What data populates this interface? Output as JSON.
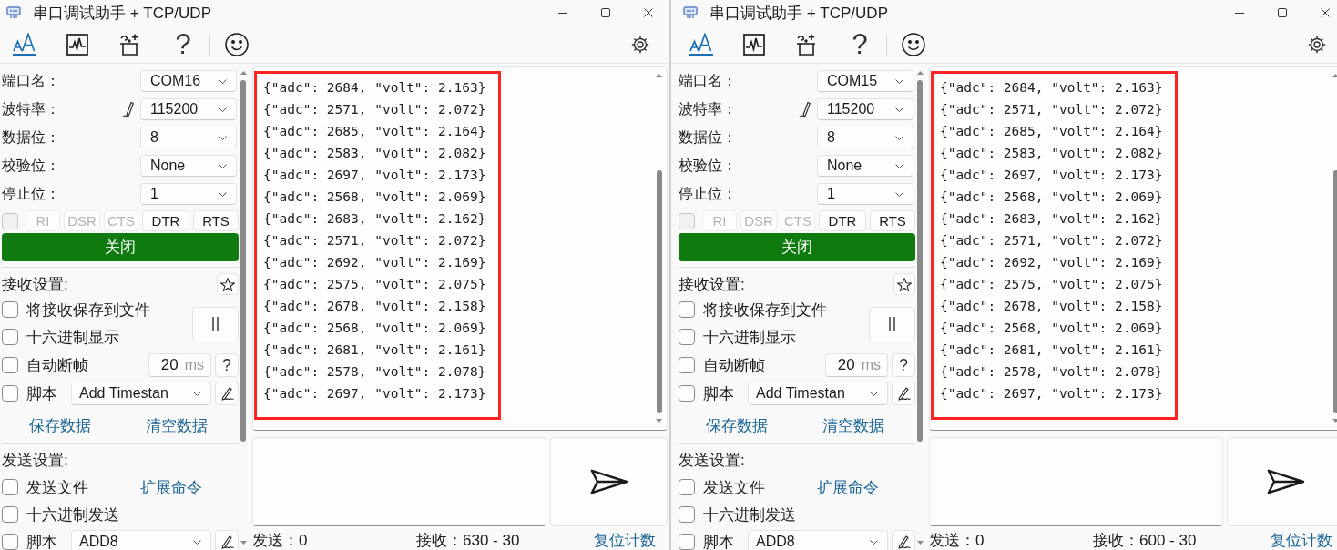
{
  "windows": [
    {
      "title": "串口调试助手 + TCP/UDP",
      "toolbar": [
        {
          "kind": "font",
          "selected": true
        },
        {
          "kind": "chart",
          "selected": false
        },
        {
          "kind": "magic",
          "selected": false
        },
        {
          "kind": "help",
          "label": "?",
          "selected": false
        },
        {
          "kind": "emoji",
          "selected": false
        }
      ],
      "port_settings": [
        {
          "label": "端口名：",
          "value": "COM16",
          "editable": false
        },
        {
          "label": "波特率：",
          "value": "115200",
          "editable": true
        },
        {
          "label": "数据位：",
          "value": "8",
          "editable": false
        },
        {
          "label": "校验位：",
          "value": "None",
          "editable": false
        },
        {
          "label": "停止位：",
          "value": "1",
          "editable": false
        }
      ],
      "signals": {
        "checked": false,
        "disabled": true,
        "lines": [
          {
            "label": "RI",
            "disabled": true
          },
          {
            "label": "DSR",
            "disabled": true
          },
          {
            "label": "CTS",
            "disabled": true
          },
          {
            "label": "DTR",
            "disabled": false
          },
          {
            "label": "RTS",
            "disabled": false
          }
        ]
      },
      "open_button": "关闭",
      "receive": {
        "title": "接收设置:",
        "options": [
          {
            "label": "将接收保存到文件",
            "checked": false
          },
          {
            "label": "十六进制显示",
            "checked": false
          }
        ],
        "auto_frame": {
          "label": "自动断帧",
          "checked": false,
          "value": "20",
          "unit": "ms",
          "help": "?"
        },
        "script": {
          "label": "脚本",
          "checked": false,
          "value": "Add Timestan"
        },
        "links": [
          "保存数据",
          "清空数据"
        ]
      },
      "send": {
        "title": "发送设置:",
        "file": {
          "label": "发送文件",
          "checked": false
        },
        "command_link": "扩展命令",
        "hex": {
          "label": "十六进制发送",
          "checked": false
        },
        "script": {
          "label": "脚本",
          "checked": false,
          "value": "ADD8"
        }
      },
      "received_lines": [
        "{\"adc\": 2684, \"volt\": 2.163}",
        "{\"adc\": 2571, \"volt\": 2.072}",
        "{\"adc\": 2685, \"volt\": 2.164}",
        "{\"adc\": 2583, \"volt\": 2.082}",
        "{\"adc\": 2697, \"volt\": 2.173}",
        "{\"adc\": 2568, \"volt\": 2.069}",
        "{\"adc\": 2683, \"volt\": 2.162}",
        "{\"adc\": 2571, \"volt\": 2.072}",
        "{\"adc\": 2692, \"volt\": 2.169}",
        "{\"adc\": 2575, \"volt\": 2.075}",
        "{\"adc\": 2678, \"volt\": 2.158}",
        "{\"adc\": 2568, \"volt\": 2.069}",
        "{\"adc\": 2681, \"volt\": 2.161}",
        "{\"adc\": 2578, \"volt\": 2.078}",
        "{\"adc\": 2697, \"volt\": 2.173}"
      ],
      "status": {
        "sent": "发送：0",
        "received": "接收：630 - 30",
        "reset": "复位计数"
      }
    },
    {
      "title": "串口调试助手 + TCP/UDP",
      "toolbar": [
        {
          "kind": "font",
          "selected": true
        },
        {
          "kind": "chart",
          "selected": false
        },
        {
          "kind": "magic",
          "selected": false
        },
        {
          "kind": "help",
          "label": "?",
          "selected": false
        },
        {
          "kind": "emoji",
          "selected": false
        }
      ],
      "port_settings": [
        {
          "label": "端口名：",
          "value": "COM15",
          "editable": false
        },
        {
          "label": "波特率：",
          "value": "115200",
          "editable": true
        },
        {
          "label": "数据位：",
          "value": "8",
          "editable": false
        },
        {
          "label": "校验位：",
          "value": "None",
          "editable": false
        },
        {
          "label": "停止位：",
          "value": "1",
          "editable": false
        }
      ],
      "signals": {
        "checked": false,
        "disabled": true,
        "lines": [
          {
            "label": "RI",
            "disabled": true
          },
          {
            "label": "DSR",
            "disabled": true
          },
          {
            "label": "CTS",
            "disabled": true
          },
          {
            "label": "DTR",
            "disabled": false
          },
          {
            "label": "RTS",
            "disabled": false
          }
        ]
      },
      "open_button": "关闭",
      "receive": {
        "title": "接收设置:",
        "options": [
          {
            "label": "将接收保存到文件",
            "checked": false
          },
          {
            "label": "十六进制显示",
            "checked": false
          }
        ],
        "auto_frame": {
          "label": "自动断帧",
          "checked": false,
          "value": "20",
          "unit": "ms",
          "help": "?"
        },
        "script": {
          "label": "脚本",
          "checked": false,
          "value": "Add Timestan"
        },
        "links": [
          "保存数据",
          "清空数据"
        ]
      },
      "send": {
        "title": "发送设置:",
        "file": {
          "label": "发送文件",
          "checked": false
        },
        "command_link": "扩展命令",
        "hex": {
          "label": "十六进制发送",
          "checked": false
        },
        "script": {
          "label": "脚本",
          "checked": false,
          "value": "ADD8"
        }
      },
      "received_lines": [
        "{\"adc\": 2684, \"volt\": 2.163}",
        "{\"adc\": 2571, \"volt\": 2.072}",
        "{\"adc\": 2685, \"volt\": 2.164}",
        "{\"adc\": 2583, \"volt\": 2.082}",
        "{\"adc\": 2697, \"volt\": 2.173}",
        "{\"adc\": 2568, \"volt\": 2.069}",
        "{\"adc\": 2683, \"volt\": 2.162}",
        "{\"adc\": 2571, \"volt\": 2.072}",
        "{\"adc\": 2692, \"volt\": 2.169}",
        "{\"adc\": 2575, \"volt\": 2.075}",
        "{\"adc\": 2678, \"volt\": 2.158}",
        "{\"adc\": 2568, \"volt\": 2.069}",
        "{\"adc\": 2681, \"volt\": 2.161}",
        "{\"adc\": 2578, \"volt\": 2.078}",
        "{\"adc\": 2697, \"volt\": 2.173}"
      ],
      "status": {
        "sent": "发送：0",
        "received": "接收：600 - 30",
        "reset": "复位计数"
      }
    }
  ]
}
